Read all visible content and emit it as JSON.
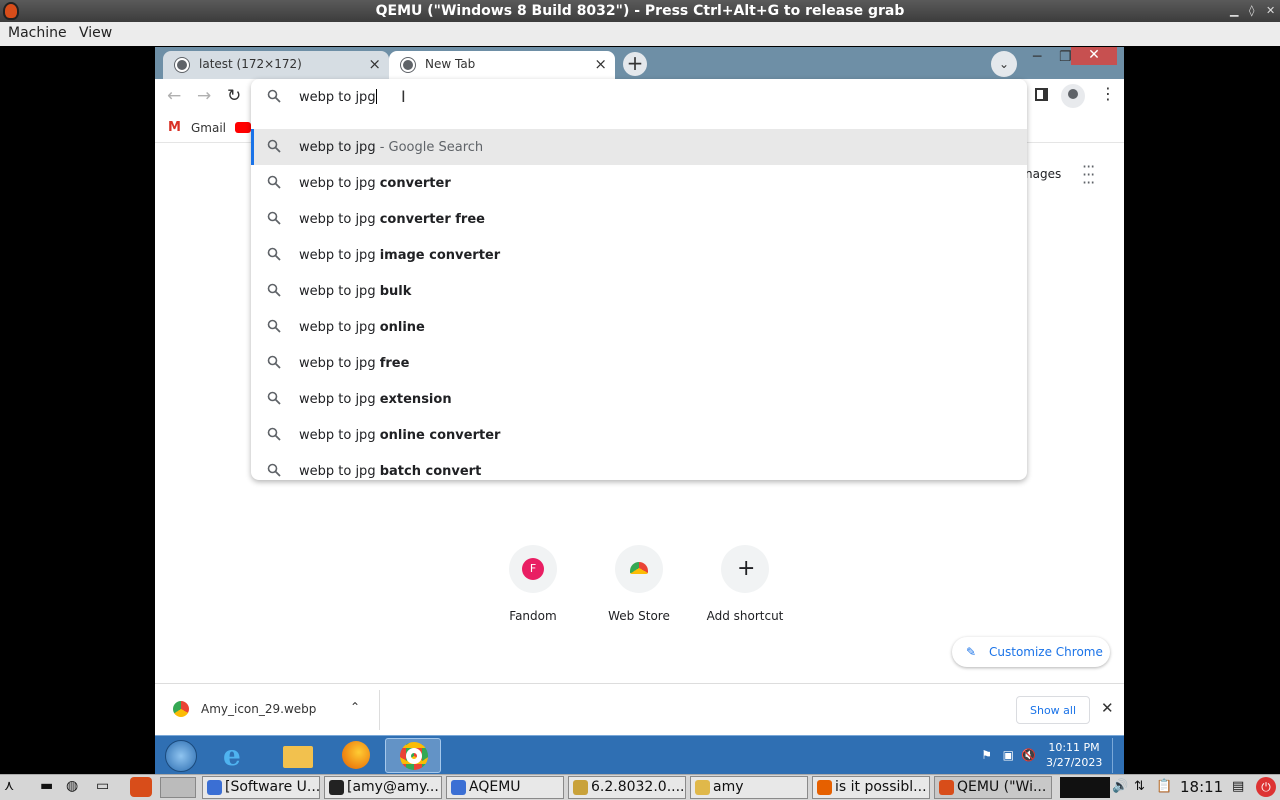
{
  "host_window": {
    "title": "QEMU (\"Windows 8 Build 8032\") - Press Ctrl+Alt+G to release grab",
    "menu": [
      "Machine",
      "View"
    ]
  },
  "browser": {
    "tabs": [
      {
        "label": "latest (172×172)",
        "active": false
      },
      {
        "label": "New Tab",
        "active": true
      }
    ],
    "omnibox": {
      "value": "webp to jpg",
      "suggestions": [
        {
          "base": "webp to jpg",
          "bold": "",
          "hint": " - Google Search",
          "selected": true
        },
        {
          "base": "webp to jpg ",
          "bold": "converter"
        },
        {
          "base": "webp to jpg ",
          "bold": "converter free"
        },
        {
          "base": "webp to jpg ",
          "bold": "image converter"
        },
        {
          "base": "webp to jpg ",
          "bold": "bulk"
        },
        {
          "base": "webp to jpg ",
          "bold": "online"
        },
        {
          "base": "webp to jpg ",
          "bold": "free"
        },
        {
          "base": "webp to jpg ",
          "bold": "extension"
        },
        {
          "base": "webp to jpg ",
          "bold": "online converter"
        },
        {
          "base": "webp to jpg ",
          "bold": "batch convert"
        }
      ]
    },
    "bookmarks": {
      "gmail": "Gmail"
    },
    "ntp": {
      "images_link": "nages",
      "shortcuts": [
        {
          "label": "Fandom",
          "initial": "F",
          "color": "#e91e63"
        },
        {
          "label": "Web Store"
        },
        {
          "label": "Add shortcut"
        }
      ],
      "customize": "Customize Chrome"
    },
    "download_bar": {
      "file": "Amy_icon_29.webp",
      "show_all": "Show all"
    }
  },
  "guest_taskbar": {
    "time": "10:11 PM",
    "date": "3/27/2023"
  },
  "host_taskbar": {
    "tasks": [
      {
        "label": "[Software U..."
      },
      {
        "label": "[amy@amy..."
      },
      {
        "label": "AQEMU"
      },
      {
        "label": "6.2.8032.0...."
      },
      {
        "label": "amy"
      },
      {
        "label": "is it possibl..."
      },
      {
        "label": "QEMU (\"Wi..."
      }
    ],
    "clock": "18:11"
  }
}
